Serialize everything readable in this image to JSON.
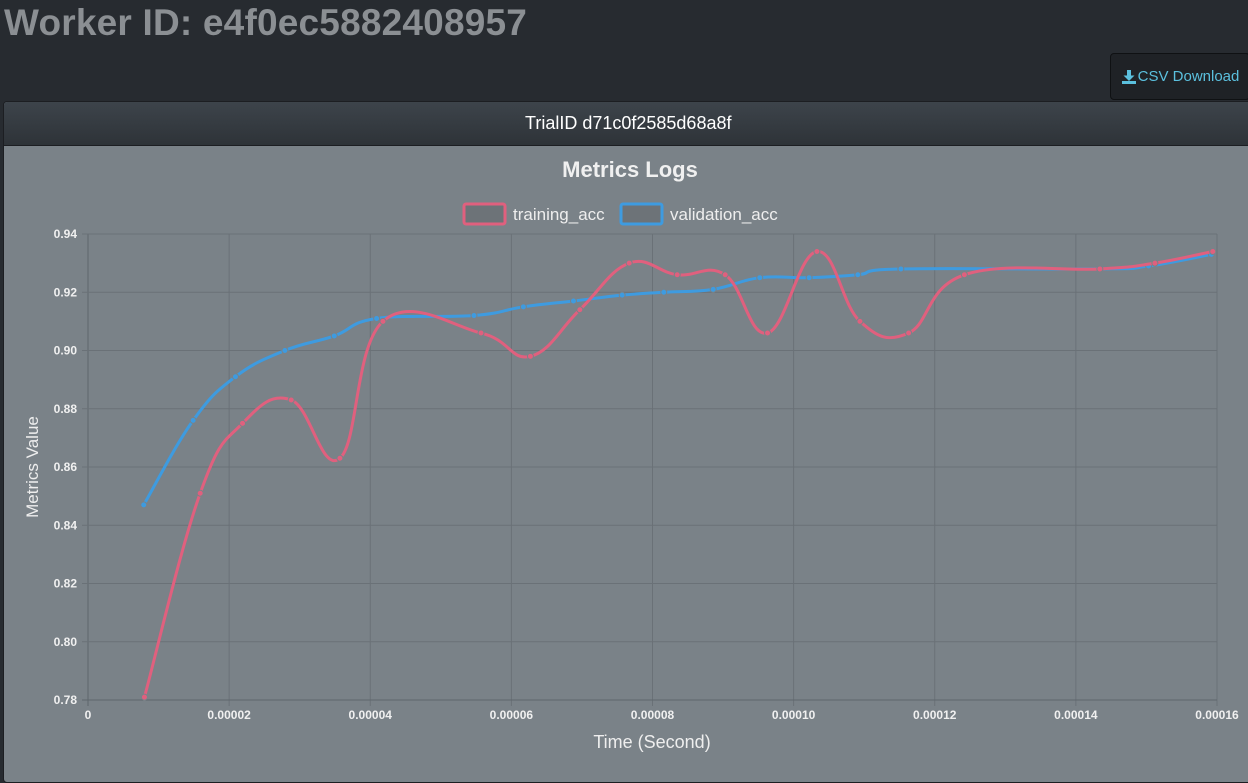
{
  "header": {
    "title": "Worker ID: e4f0ec5882408957"
  },
  "toolbar": {
    "csv_label": "CSV Download",
    "csv_icon": "download-icon"
  },
  "panel": {
    "heading": "TrialID d71c0f2585d68a8f"
  },
  "colors": {
    "training": "#e0607e",
    "validation": "#3e9be0",
    "link": "#5bc0de"
  },
  "chart_data": {
    "type": "line",
    "title": "Metrics Logs",
    "xlabel": "Time (Second)",
    "ylabel": "Metrics Value",
    "xlim": [
      0,
      0.00016
    ],
    "ylim": [
      0.78,
      0.94
    ],
    "x_ticks": [
      "0",
      "0.00002",
      "0.00004",
      "0.00006",
      "0.00008",
      "0.00010",
      "0.00012",
      "0.00014",
      "0.00016"
    ],
    "y_ticks": [
      "0.94",
      "0.92",
      "0.90",
      "0.88",
      "0.86",
      "0.84",
      "0.82",
      "0.80",
      "0.78"
    ],
    "grid": true,
    "legend": "top",
    "series": [
      {
        "name": "training_acc",
        "color": "#e0607e",
        "points": [
          [
            8e-06,
            0.781
          ],
          [
            1.59e-05,
            0.851
          ],
          [
            2.19e-05,
            0.875
          ],
          [
            2.88e-05,
            0.883
          ],
          [
            3.57e-05,
            0.863
          ],
          [
            4.18e-05,
            0.91
          ],
          [
            5.57e-05,
            0.906
          ],
          [
            6.27e-05,
            0.898
          ],
          [
            6.97e-05,
            0.914
          ],
          [
            7.67e-05,
            0.93
          ],
          [
            8.35e-05,
            0.926
          ],
          [
            9.03e-05,
            0.926
          ],
          [
            9.63e-05,
            0.906
          ],
          [
            0.0001033,
            0.934
          ],
          [
            0.0001094,
            0.91
          ],
          [
            0.0001163,
            0.906
          ],
          [
            0.0001242,
            0.926
          ],
          [
            0.0001434,
            0.928
          ],
          [
            0.0001512,
            0.93
          ],
          [
            0.0001594,
            0.934
          ]
        ]
      },
      {
        "name": "validation_acc",
        "color": "#3e9be0",
        "points": [
          [
            7.9e-06,
            0.847
          ],
          [
            1.49e-05,
            0.876
          ],
          [
            2.09e-05,
            0.891
          ],
          [
            2.79e-05,
            0.9
          ],
          [
            3.49e-05,
            0.905
          ],
          [
            4.09e-05,
            0.911
          ],
          [
            5.47e-05,
            0.912
          ],
          [
            6.17e-05,
            0.915
          ],
          [
            6.88e-05,
            0.917
          ],
          [
            7.57e-05,
            0.919
          ],
          [
            8.16e-05,
            0.92
          ],
          [
            8.86e-05,
            0.921
          ],
          [
            9.52e-05,
            0.925
          ],
          [
            0.0001022,
            0.925
          ],
          [
            0.0001091,
            0.926
          ],
          [
            0.0001152,
            0.928
          ],
          [
            0.0001432,
            0.928
          ],
          [
            0.0001503,
            0.929
          ],
          [
            0.0001592,
            0.933
          ]
        ]
      }
    ]
  }
}
